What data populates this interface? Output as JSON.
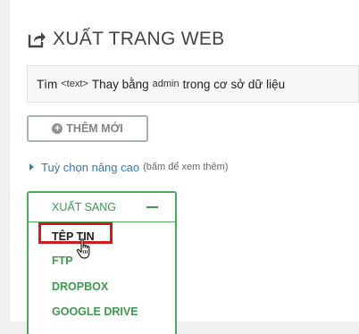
{
  "page": {
    "title": "XUẤT TRANG WEB"
  },
  "search": {
    "find_label": "Tìm",
    "text_placeholder": "<text>",
    "replace_label": "Thay bằng",
    "replace_value": "admin",
    "suffix": "trong cơ sở dữ liệu"
  },
  "actions": {
    "add_new_label": "THÊM MỚI"
  },
  "advanced": {
    "link_label": "Tuỳ chọn nâng cao",
    "hint": "(bấm để xem thêm)"
  },
  "export_to": {
    "header": "XUẤT SANG",
    "items": [
      "TỆP TIN",
      "FTP",
      "DROPBOX",
      "GOOGLE DRIVE"
    ]
  },
  "colors": {
    "accent_green": "#3c9a4c",
    "highlight_red": "#d21a1a",
    "link_blue": "#2f7bbd"
  }
}
